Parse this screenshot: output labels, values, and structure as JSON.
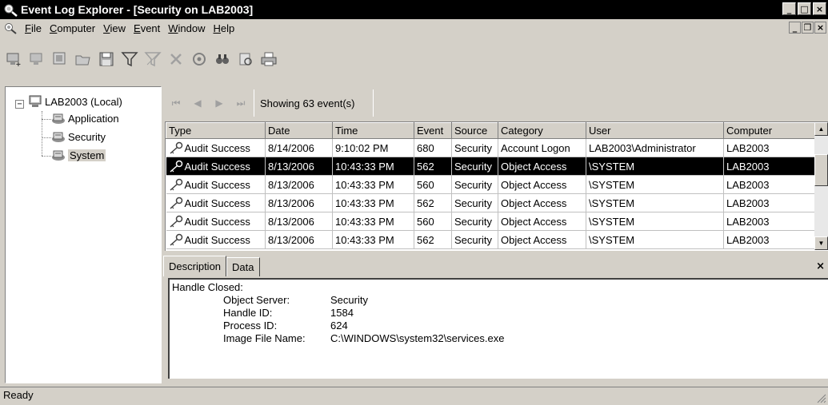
{
  "window": {
    "title": "Event Log Explorer - [Security on LAB2003]",
    "controls": {
      "minimize": "_",
      "maximize": "□",
      "close": "×"
    }
  },
  "menu": {
    "items": [
      {
        "label": "File",
        "accel": "F"
      },
      {
        "label": "Computer",
        "accel": "C"
      },
      {
        "label": "View",
        "accel": "V"
      },
      {
        "label": "Event",
        "accel": "E"
      },
      {
        "label": "Window",
        "accel": "W"
      },
      {
        "label": "Help",
        "accel": "H"
      }
    ],
    "mdi_controls": {
      "minimize": "_",
      "restore": "❐",
      "close": "×"
    }
  },
  "toolbar": {
    "buttons": [
      {
        "icon": "add-computer-icon"
      },
      {
        "icon": "remove-computer-icon"
      },
      {
        "icon": "open-log-icon"
      },
      {
        "icon": "open-folder-icon"
      },
      {
        "icon": "save-icon"
      },
      {
        "icon": "filter-icon"
      },
      {
        "icon": "clear-filter-icon"
      },
      {
        "icon": "delete-icon"
      },
      {
        "icon": "refresh-icon"
      },
      {
        "icon": "find-icon"
      },
      {
        "icon": "properties-icon"
      },
      {
        "icon": "print-icon"
      }
    ]
  },
  "tree": {
    "root": {
      "label": "LAB2003 (Local)",
      "expander": "−",
      "icon": "computer-icon"
    },
    "children": [
      {
        "label": "Application",
        "icon": "log-icon",
        "selected": false
      },
      {
        "label": "Security",
        "icon": "log-icon",
        "selected": false
      },
      {
        "label": "System",
        "icon": "log-icon",
        "selected": true
      }
    ]
  },
  "navigation": {
    "first": "⏮",
    "prev": "◀",
    "next": "▶",
    "last": "⏭",
    "status": "Showing 63 event(s)"
  },
  "grid": {
    "columns": [
      "Type",
      "Date",
      "Time",
      "Event",
      "Source",
      "Category",
      "User",
      "Computer"
    ],
    "rows": [
      {
        "type": "Audit Success",
        "date": "8/14/2006",
        "time": "9:10:02 PM",
        "event": "680",
        "source": "Security",
        "category": "Account Logon",
        "user": "LAB2003\\Administrator",
        "computer": "LAB2003",
        "selected": false
      },
      {
        "type": "Audit Success",
        "date": "8/13/2006",
        "time": "10:43:33 PM",
        "event": "562",
        "source": "Security",
        "category": "Object Access",
        "user": "\\SYSTEM",
        "computer": "LAB2003",
        "selected": true
      },
      {
        "type": "Audit Success",
        "date": "8/13/2006",
        "time": "10:43:33 PM",
        "event": "560",
        "source": "Security",
        "category": "Object Access",
        "user": "\\SYSTEM",
        "computer": "LAB2003",
        "selected": false
      },
      {
        "type": "Audit Success",
        "date": "8/13/2006",
        "time": "10:43:33 PM",
        "event": "562",
        "source": "Security",
        "category": "Object Access",
        "user": "\\SYSTEM",
        "computer": "LAB2003",
        "selected": false
      },
      {
        "type": "Audit Success",
        "date": "8/13/2006",
        "time": "10:43:33 PM",
        "event": "560",
        "source": "Security",
        "category": "Object Access",
        "user": "\\SYSTEM",
        "computer": "LAB2003",
        "selected": false
      },
      {
        "type": "Audit Success",
        "date": "8/13/2006",
        "time": "10:43:33 PM",
        "event": "562",
        "source": "Security",
        "category": "Object Access",
        "user": "\\SYSTEM",
        "computer": "LAB2003",
        "selected": false
      }
    ],
    "scroll": {
      "up": "▲",
      "down": "▼"
    }
  },
  "detail": {
    "tabs": [
      {
        "label": "Description",
        "active": true
      },
      {
        "label": "Data",
        "active": false
      }
    ],
    "close": "×",
    "heading": "Handle Closed:",
    "fields": [
      {
        "key": "Object Server:",
        "value": "Security"
      },
      {
        "key": "Handle ID:",
        "value": "1584"
      },
      {
        "key": "Process ID:",
        "value": "624"
      },
      {
        "key": "Image File Name:",
        "value": "C:\\WINDOWS\\system32\\services.exe"
      }
    ]
  },
  "status": {
    "text": "Ready"
  },
  "colors": {
    "chrome": "#d4d0c8",
    "title_bg": "#000000",
    "selection_bg": "#000000",
    "selection_fg": "#ffffff"
  }
}
